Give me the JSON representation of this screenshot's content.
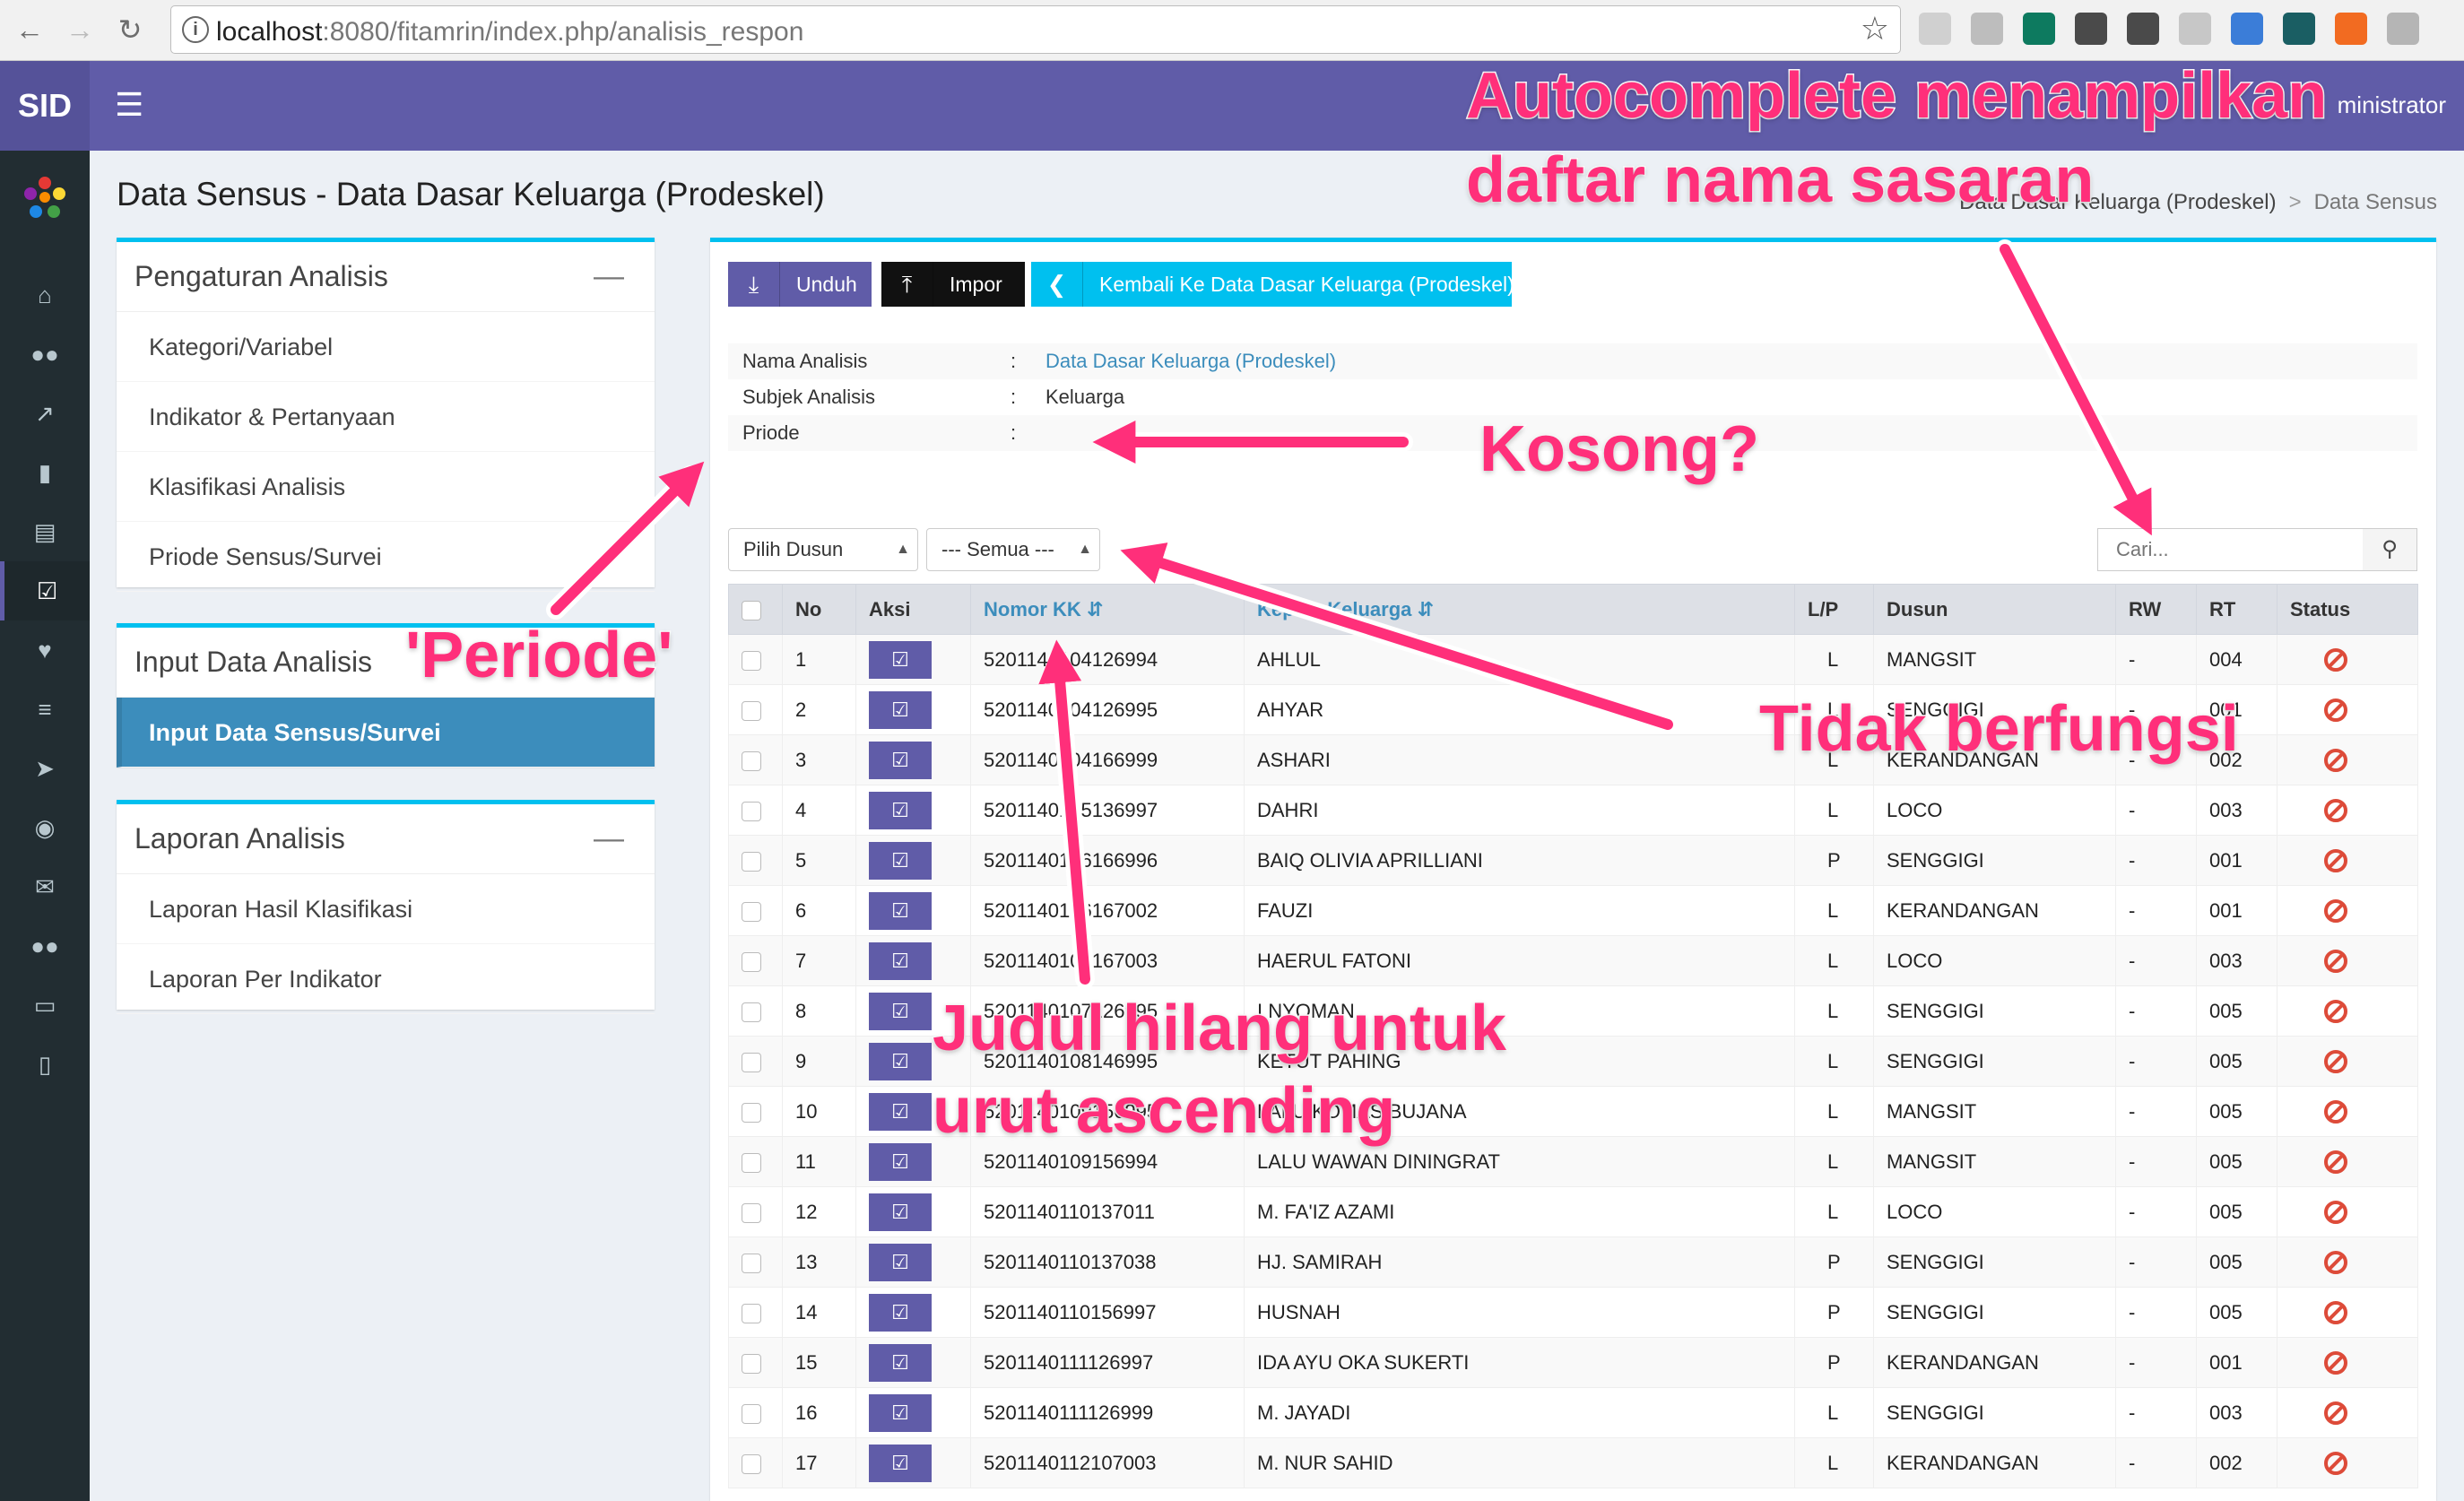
{
  "browser": {
    "url_host": "localhost",
    "url_path": ":8080/fitamrin/index.php/analisis_respon",
    "back_icon": "back-arrow-icon",
    "forward_icon": "forward-arrow-icon",
    "reload_icon": "reload-icon",
    "extension_colors": [
      "#d0d0d0",
      "#bdbdbd",
      "#0d7a5f",
      "#4a4a4a",
      "#4a4a4a",
      "#c7c7c7",
      "#3b7dd8",
      "#1a5e63",
      "#f26b21",
      "#b5b5b5"
    ]
  },
  "header": {
    "brand": "SID",
    "menu_icon": "hamburger-icon",
    "user": "ministrator",
    "theme_color": "#605ca8"
  },
  "sidebar": {
    "icons": [
      "home-icon",
      "users-icon",
      "chart-icon",
      "book-icon",
      "archive-icon",
      "check-square-icon",
      "heart-icon",
      "sliders-icon",
      "location-arrow-icon",
      "globe-icon",
      "envelope-icon",
      "users-icon",
      "desktop-icon",
      "inbox-icon"
    ],
    "active_index": 5
  },
  "page": {
    "title": "Data Sensus - Data Dasar Keluarga (Prodeskel)",
    "breadcrumb": [
      "Data Dasar Keluarga (Prodeskel)",
      "Data Sensus"
    ]
  },
  "left_panels": {
    "pengaturan": {
      "title": "Pengaturan Analisis",
      "items": [
        "Kategori/Variabel",
        "Indikator & Pertanyaan",
        "Klasifikasi Analisis",
        "Priode Sensus/Survei"
      ]
    },
    "input": {
      "title": "Input Data Analisis",
      "items": [
        "Input Data Sensus/Survei"
      ]
    },
    "laporan": {
      "title": "Laporan Analisis",
      "items": [
        "Laporan Hasil Klasifikasi",
        "Laporan Per Indikator"
      ]
    }
  },
  "toolbar": {
    "unduh": "Unduh",
    "impor": "Impor",
    "kembali": "Kembali Ke Data Dasar Keluarga (Prodeskel)"
  },
  "info": {
    "rows": [
      {
        "label": "Nama Analisis",
        "value": "Data Dasar Keluarga (Prodeskel)",
        "link": true
      },
      {
        "label": "Subjek Analisis",
        "value": "Keluarga",
        "link": false
      },
      {
        "label": "Priode",
        "value": "",
        "link": false
      }
    ]
  },
  "filters": {
    "dusun": "Pilih Dusun",
    "semua": "--- Semua ---",
    "search_placeholder": "Cari..."
  },
  "table": {
    "headers": [
      "No",
      "Aksi",
      "Nomor KK",
      "Kepala Keluarga",
      "L/P",
      "Dusun",
      "RW",
      "RT",
      "Status"
    ],
    "rows": [
      {
        "no": "1",
        "kk": "5201140104126994",
        "nama": "AHLUL",
        "lp": "L",
        "dusun": "MANGSIT",
        "rw": "-",
        "rt": "004"
      },
      {
        "no": "2",
        "kk": "5201140104126995",
        "nama": "AHYAR",
        "lp": "L",
        "dusun": "SENGGIGI",
        "rw": "-",
        "rt": "001"
      },
      {
        "no": "3",
        "kk": "5201140104166999",
        "nama": "ASHARI",
        "lp": "L",
        "dusun": "KERANDANGAN",
        "rw": "-",
        "rt": "002"
      },
      {
        "no": "4",
        "kk": "5201140105136997",
        "nama": "DAHRI",
        "lp": "L",
        "dusun": "LOCO",
        "rw": "-",
        "rt": "003"
      },
      {
        "no": "5",
        "kk": "5201140106166996",
        "nama": "BAIQ OLIVIA APRILLIANI",
        "lp": "P",
        "dusun": "SENGGIGI",
        "rw": "-",
        "rt": "001"
      },
      {
        "no": "6",
        "kk": "5201140106167002",
        "nama": "FAUZI",
        "lp": "L",
        "dusun": "KERANDANGAN",
        "rw": "-",
        "rt": "001"
      },
      {
        "no": "7",
        "kk": "5201140106167003",
        "nama": "HAERUL FATONI",
        "lp": "L",
        "dusun": "LOCO",
        "rw": "-",
        "rt": "003"
      },
      {
        "no": "8",
        "kk": "5201140107126995",
        "nama": "I NYOMAN",
        "lp": "L",
        "dusun": "SENGGIGI",
        "rw": "-",
        "rt": "005"
      },
      {
        "no": "9",
        "kk": "5201140108146995",
        "nama": "KETUT PAHING",
        "lp": "L",
        "dusun": "SENGGIGI",
        "rw": "-",
        "rt": "005"
      },
      {
        "no": "10",
        "kk": "5201140109156995",
        "nama": "LALU KOMAS BUJANA",
        "lp": "L",
        "dusun": "MANGSIT",
        "rw": "-",
        "rt": "005"
      },
      {
        "no": "11",
        "kk": "5201140109156994",
        "nama": "LALU WAWAN DININGRAT",
        "lp": "L",
        "dusun": "MANGSIT",
        "rw": "-",
        "rt": "005"
      },
      {
        "no": "12",
        "kk": "5201140110137011",
        "nama": "M. FA'IZ AZAMI",
        "lp": "L",
        "dusun": "LOCO",
        "rw": "-",
        "rt": "005"
      },
      {
        "no": "13",
        "kk": "5201140110137038",
        "nama": "HJ. SAMIRAH",
        "lp": "P",
        "dusun": "SENGGIGI",
        "rw": "-",
        "rt": "005"
      },
      {
        "no": "14",
        "kk": "5201140110156997",
        "nama": "HUSNAH",
        "lp": "P",
        "dusun": "SENGGIGI",
        "rw": "-",
        "rt": "005"
      },
      {
        "no": "15",
        "kk": "5201140111126997",
        "nama": "IDA AYU OKA SUKERTI",
        "lp": "P",
        "dusun": "KERANDANGAN",
        "rw": "-",
        "rt": "001"
      },
      {
        "no": "16",
        "kk": "5201140111126999",
        "nama": "M. JAYADI",
        "lp": "L",
        "dusun": "SENGGIGI",
        "rw": "-",
        "rt": "003"
      },
      {
        "no": "17",
        "kk": "5201140112107003",
        "nama": "M. NUR SAHID",
        "lp": "L",
        "dusun": "KERANDANGAN",
        "rw": "-",
        "rt": "002"
      }
    ]
  },
  "annotations": {
    "autocomplete_1": "Autocomplete menampilkan",
    "autocomplete_2": "daftar nama sasaran",
    "kosong": "Kosong?",
    "periode": "'Periode'",
    "tidak": "Tidak berfungsi",
    "judul_1": "Judul hilang untuk",
    "judul_2": "urut ascending",
    "color": "#ff2f7a"
  }
}
